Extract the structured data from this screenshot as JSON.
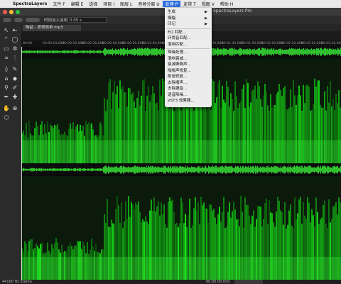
{
  "menubar": {
    "app": "SpectraLayers",
    "items": [
      "文件 F",
      "编辑 E",
      "选择",
      "项目 I",
      "图层 L",
      "音频分离 U",
      "处理 P",
      "走带 T",
      "视图 V",
      "帮助 H"
    ],
    "active_index": 6
  },
  "window": {
    "title": "SpectraLayers Pro"
  },
  "toolbar": {
    "fade_label": "时间淡入淡出",
    "fade_value": "0.05 s"
  },
  "tab": {
    "filename": "陶喆 - 爱很简单.mp3"
  },
  "ruler": {
    "ticks": [
      "00:00",
      "00:00:10,000",
      "00:00:20,000",
      "00:00:30,000",
      "00:00:40,000",
      "00:00:50,000",
      "00:01:00,000",
      "00:01:10,000",
      "00:01:20,000",
      "00:01:30,000",
      "00:01:40,000",
      "00:01:50,000",
      "00:02:00,000",
      "00:02:10,000",
      "00:02:20,000",
      "00:02:30,000"
    ]
  },
  "process_menu": {
    "items": [
      {
        "label": "生成",
        "submenu": true
      },
      {
        "label": "振幅",
        "submenu": true
      },
      {
        "label": "印记",
        "submenu": true
      },
      {
        "label": "EQ 匹配...",
        "submenu": false
      },
      {
        "label": "环境音匹配...",
        "submenu": false
      },
      {
        "label": "混响匹配...",
        "submenu": false
      },
      {
        "label": "降噪处理...",
        "submenu": false
      },
      {
        "label": "混响衰减...",
        "submenu": false
      },
      {
        "label": "衰减嘶嘶声...",
        "submenu": false
      },
      {
        "label": "嗡嗡声修复...",
        "submenu": false
      },
      {
        "label": "削波修复...",
        "submenu": false
      },
      {
        "label": "去除嘴声...",
        "submenu": false
      },
      {
        "label": "去除漏音...",
        "submenu": false
      },
      {
        "label": "语音降噪...",
        "submenu": false
      },
      {
        "label": "VST3 效果器...",
        "submenu": false
      }
    ]
  },
  "status": {
    "format": "44100 Hz Stereo",
    "time": "00:00:00,000"
  },
  "colors": {
    "accent": "#2f6fe0",
    "spectrum": "#2fd52f"
  }
}
